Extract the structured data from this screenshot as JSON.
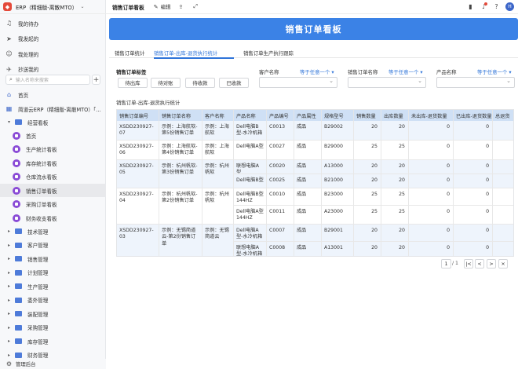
{
  "app": {
    "name": "ERP（精细版-离散MTO）"
  },
  "sidebar": {
    "personal": [
      {
        "label": "我的待办",
        "icon": "bell-icon"
      },
      {
        "label": "我发起的",
        "icon": "send-icon"
      },
      {
        "label": "我处理的",
        "icon": "user-icon"
      },
      {
        "label": "抄送我的",
        "icon": "send-copy-icon"
      }
    ],
    "search_placeholder": "输入名称来搜索",
    "home": "首页",
    "project": "简道云ERP（精细版-离散MTO）「...",
    "group": "经营看板",
    "boards": [
      "首页",
      "生产统计看板",
      "库存统计看板",
      "仓库流水看板",
      "销售订单看板",
      "采购订单看板",
      "财务收支看板"
    ],
    "folders": [
      "技术管理",
      "客户管理",
      "销售管理",
      "计划管理",
      "生产管理",
      "委外管理",
      "装配管理",
      "采购管理",
      "库存管理",
      "财务管理"
    ],
    "admin": "管理后台"
  },
  "topbar": {
    "title": "销售订单看板",
    "edit": "编辑",
    "avatar": "H"
  },
  "banner": {
    "title": "销售订单看板"
  },
  "tabs": [
    "销售订单统计",
    "销售订单-出库-退货执行统计",
    "销售订单生产执行跟踪"
  ],
  "filter": {
    "label": "销售订单标签",
    "buttons": [
      "待出库",
      "待对账",
      "待收款",
      "已收款"
    ],
    "fields": [
      {
        "label": "客户名称",
        "cond": "等于任意一个 ▾"
      },
      {
        "label": "销售订单名称",
        "cond": "等于任意一个 ▾"
      },
      {
        "label": "产品名称",
        "cond": "等于任意一个 ▾"
      }
    ]
  },
  "table": {
    "title": "销售订单-出库-退货执行统计",
    "headers": [
      "销售订单编号",
      "销售订单名称",
      "客户名称",
      "产品名称",
      "产品编号",
      "产品属性",
      "规格型号",
      "销售数量",
      "出库数量",
      "未出库-退货数量",
      "已出库-退货数量",
      "总退货"
    ],
    "orders": [
      {
        "no": "XSDD230927-07",
        "name": "示例：上海航软-第5份销售订单",
        "customer": "示例：上海航软",
        "items": [
          {
            "product": "Dell电脑B型-水冷机箱",
            "code": "C0013",
            "attr": "成品",
            "spec": "B29002",
            "qty": "20",
            "out": "20",
            "r1": "0",
            "r2": "0"
          }
        ]
      },
      {
        "no": "XSDD230927-06",
        "name": "示例：上海航软-第4份销售订单",
        "customer": "示例：上海航软",
        "items": [
          {
            "product": "Dell电脑A型",
            "code": "C0027",
            "attr": "成品",
            "spec": "B29000",
            "qty": "25",
            "out": "25",
            "r1": "0",
            "r2": "0"
          }
        ]
      },
      {
        "no": "XSDD230927-05",
        "name": "示例：杭州帆软-第3份销售订单",
        "customer": "示例：杭州帆软",
        "items": [
          {
            "product": "联想电脑A型",
            "code": "C0020",
            "attr": "成品",
            "spec": "A13000",
            "qty": "20",
            "out": "20",
            "r1": "0",
            "r2": "0"
          },
          {
            "product": "Dell电脑B型",
            "code": "C0025",
            "attr": "成品",
            "spec": "B21000",
            "qty": "20",
            "out": "20",
            "r1": "0",
            "r2": "0"
          }
        ]
      },
      {
        "no": "XSDD230927-04",
        "name": "示例：杭州帆软-第2份销售订单",
        "customer": "示例：杭州帆软",
        "items": [
          {
            "product": "Dell电脑B型144HZ",
            "code": "C0010",
            "attr": "成品",
            "spec": "B23000",
            "qty": "25",
            "out": "25",
            "r1": "0",
            "r2": "0"
          },
          {
            "product": "Dell电脑A型144HZ",
            "code": "C0011",
            "attr": "成品",
            "spec": "A23000",
            "qty": "25",
            "out": "25",
            "r1": "0",
            "r2": "0"
          }
        ]
      },
      {
        "no": "XSDD230927-03",
        "name": "示例：无锡简道云-第2份销售订单",
        "customer": "示例：无锡简道云",
        "items": [
          {
            "product": "Dell电脑A型-水冷机箱",
            "code": "C0007",
            "attr": "成品",
            "spec": "B29001",
            "qty": "20",
            "out": "20",
            "r1": "0",
            "r2": "0"
          },
          {
            "product": "联想电脑A型-水冷机箱",
            "code": "C0008",
            "attr": "成品",
            "spec": "A13001",
            "qty": "20",
            "out": "20",
            "r1": "0",
            "r2": "0"
          }
        ]
      }
    ]
  },
  "pagination": {
    "page": "1",
    "total": "/ 1",
    "first": "|<",
    "prev": "<",
    "next": ">",
    "last": ">|",
    "close": "×"
  },
  "colors": {
    "accent": "#2f74d9",
    "banner": "#3b82e6",
    "header_row": "#cfe0f5",
    "alt_row": "#eef4fc",
    "board_icon": "#8a4bd6",
    "folder_icon": "#4e7bd9"
  }
}
